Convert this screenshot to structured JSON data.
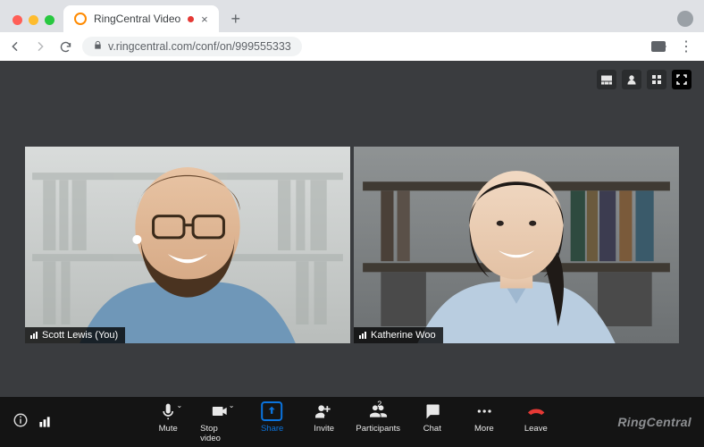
{
  "browser": {
    "tab_title": "RingCentral Video",
    "url_display": "v.ringcentral.com/conf/on/999555333"
  },
  "view_controls": {
    "film_strip": "film-strip-view",
    "speaker": "speaker-view",
    "gallery": "gallery-view",
    "fullscreen": "fullscreen"
  },
  "participants": [
    {
      "name": "Scott Lewis (You)"
    },
    {
      "name": "Katherine Woo"
    }
  ],
  "controls": {
    "mute": "Mute",
    "stop_video": "Stop video",
    "share": "Share",
    "invite": "Invite",
    "participants": "Participants",
    "participants_badge": "2",
    "chat": "Chat",
    "more": "More",
    "leave": "Leave"
  },
  "brand": "RingCentral"
}
